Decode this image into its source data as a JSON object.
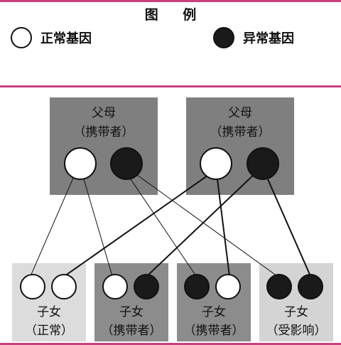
{
  "legend": {
    "title": "图 例",
    "normal_label": "正常基因",
    "abnormal_label": "异常基因"
  },
  "parents": [
    {
      "title": "父母",
      "subtitle": "（携带者）"
    },
    {
      "title": "父母",
      "subtitle": "（携带者）"
    }
  ],
  "children": [
    {
      "title": "子女",
      "subtitle": "（正常）",
      "genes": [
        "normal",
        "normal"
      ],
      "tone": "light"
    },
    {
      "title": "子女",
      "subtitle": "（携带者）",
      "genes": [
        "normal",
        "abnormal"
      ],
      "tone": "dark"
    },
    {
      "title": "子女",
      "subtitle": "（携带者）",
      "genes": [
        "abnormal",
        "normal"
      ],
      "tone": "dark"
    },
    {
      "title": "子女",
      "subtitle": "（受影响）",
      "genes": [
        "abnormal",
        "abnormal"
      ],
      "tone": "lighter"
    }
  ],
  "colors": {
    "accent_rule": "#c8417f",
    "parent_box": "#7f7f7f",
    "child_dark": "#8c8c8c",
    "child_light": "#dcdcdc",
    "child_lighter": "#d4d4d4",
    "normal_fill": "#ffffff",
    "abnormal_fill": "#1a1a1a"
  }
}
